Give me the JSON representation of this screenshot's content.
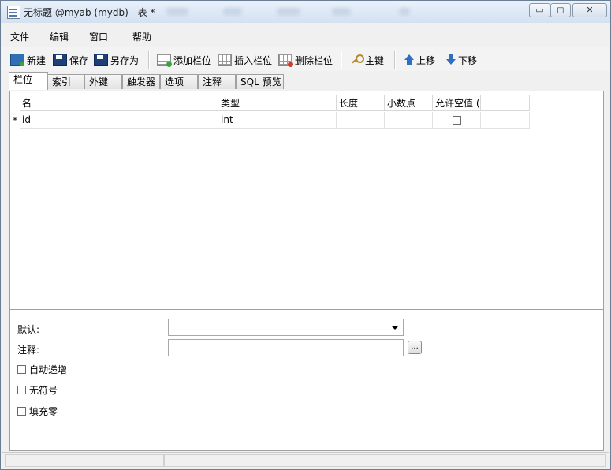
{
  "window": {
    "title": "无标题 @myab (mydb) - 表 *",
    "min_glyph": "▭",
    "max_glyph": "◻",
    "close_glyph": "✕"
  },
  "menu": [
    "文件",
    "编辑",
    "窗口",
    "帮助"
  ],
  "toolbar": {
    "new": "新建",
    "save": "保存",
    "saveas": "另存为",
    "add_field": "添加栏位",
    "insert_field": "插入栏位",
    "delete_field": "删除栏位",
    "primary_key": "主键",
    "move_up": "上移",
    "move_down": "下移"
  },
  "tabs": [
    "栏位",
    "索引",
    "外键",
    "触发器",
    "选项",
    "注释",
    "SQL 预览"
  ],
  "grid": {
    "columns": [
      "名",
      "类型",
      "长度",
      "小数点",
      "允许空值 ("
    ],
    "rows": [
      {
        "marker": "*",
        "name": "id",
        "type": "int",
        "length": "",
        "decimals": "",
        "allow_null": false
      }
    ]
  },
  "properties": {
    "default_label": "默认:",
    "comment_label": "注释:",
    "dots_label": "...",
    "auto_increment": "自动递增",
    "unsigned": "无符号",
    "zerofill": "填充零"
  }
}
